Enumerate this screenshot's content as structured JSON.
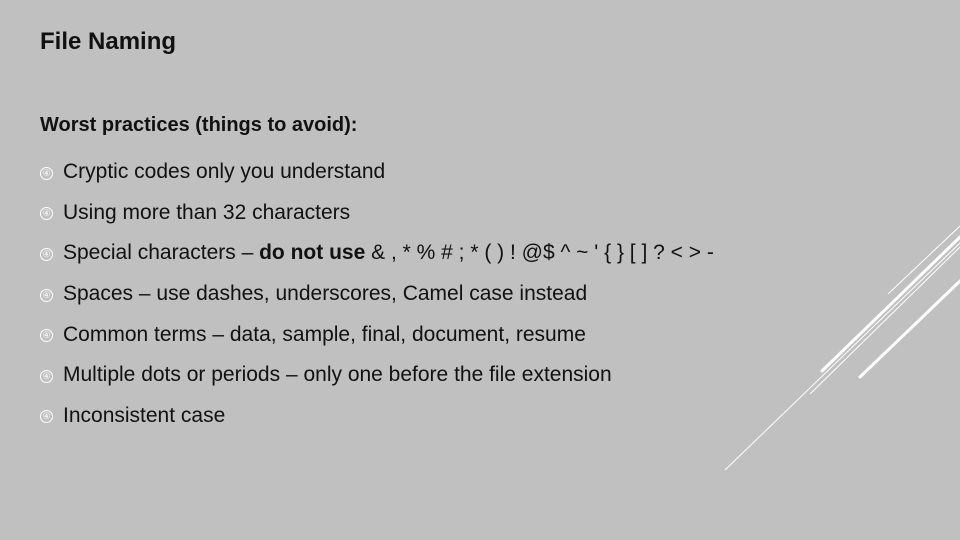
{
  "slide": {
    "title": "File Naming",
    "subtitle": "Worst practices (things to avoid):",
    "bullet_icon": "circled-digit-four",
    "bullet_glyph": "④",
    "bullets": [
      {
        "text": "Cryptic codes only you understand"
      },
      {
        "text": "Using more than 32 characters"
      },
      {
        "text_before": "Special characters – ",
        "bold": "do not use",
        "text_after": " & , * % # ; * ( ) ! @$ ^ ~ ' { } [ ] ? < > -"
      },
      {
        "text": "Spaces – use dashes, underscores, Camel case instead"
      },
      {
        "text": "Common terms – data, sample, final, document, resume"
      },
      {
        "text": "Multiple dots or periods – only one before the file extension"
      },
      {
        "text": "Inconsistent case"
      }
    ]
  },
  "colors": {
    "background": "#c0c0c0",
    "text": "#111111",
    "decor": "#ffffff"
  }
}
